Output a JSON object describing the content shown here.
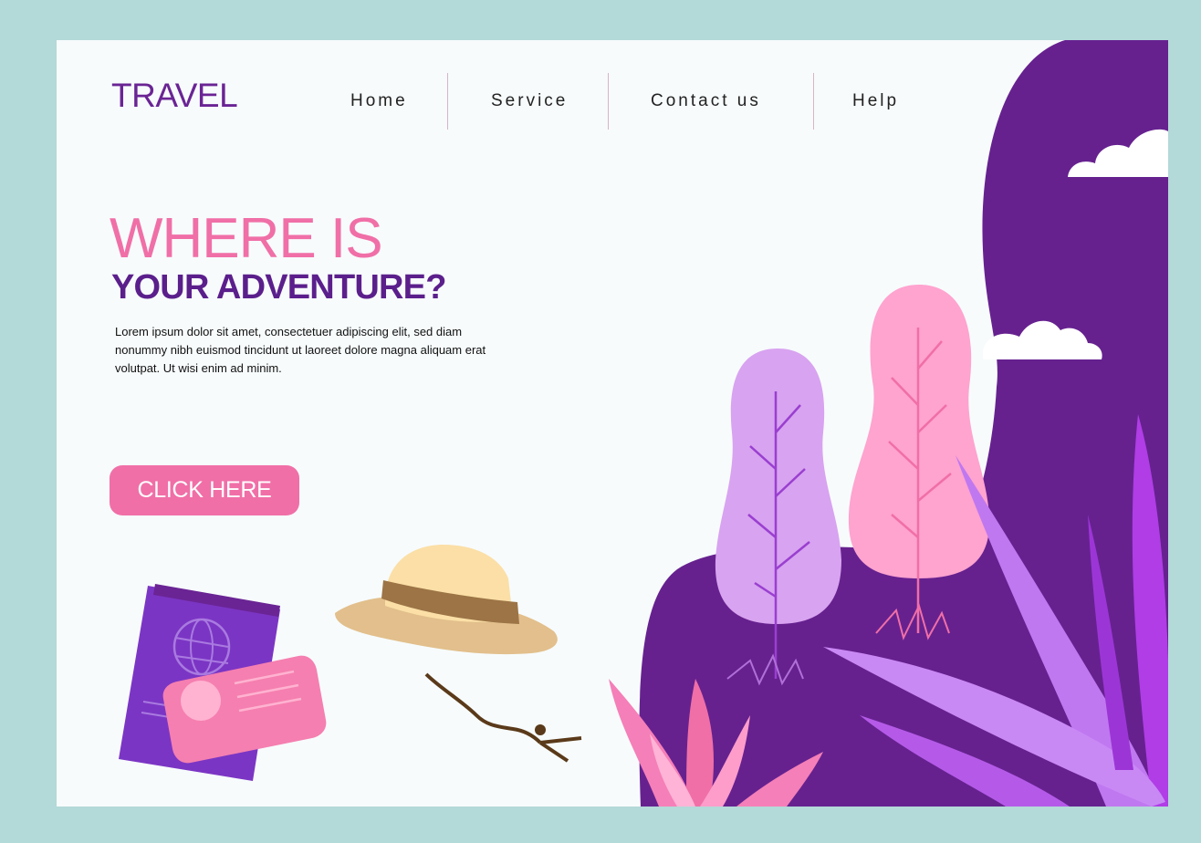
{
  "brand": {
    "logo_text": "TRAVEL",
    "primary_color": "#6a2494",
    "accent_color": "#f06fa7"
  },
  "nav": {
    "items": [
      {
        "label": "Home"
      },
      {
        "label": "Service"
      },
      {
        "label": "Contact us"
      },
      {
        "label": "Help"
      }
    ]
  },
  "hero": {
    "title_line1": "WHERE IS",
    "title_line2": "YOUR ADVENTURE?",
    "body": "Lorem ipsum dolor sit amet, consectetuer adipiscing elit, sed diam nonummy nibh euismod tincidunt ut laoreet dolore magna aliquam erat volutpat. Ut wisi enim ad minim.",
    "cta_label": "CLICK HERE"
  },
  "illustration": {
    "icons": [
      "passport-icon",
      "id-card-icon",
      "hat-icon",
      "tree-icon",
      "cloud-icon",
      "leaf-icon"
    ]
  }
}
